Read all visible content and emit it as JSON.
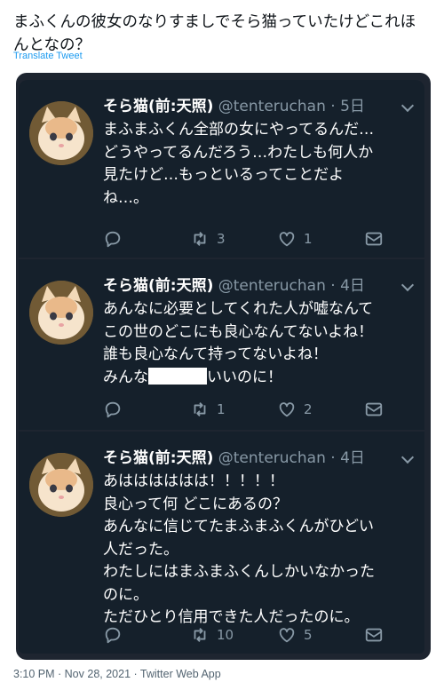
{
  "tweet": {
    "text": "まふくんの彼女のなりすましでそら猫っていたけどこれほんとなの？",
    "translate_label": "Translate Tweet",
    "timestamp": "3:10 PM · Nov 28, 2021",
    "source": "Twitter Web App"
  },
  "screenshot": {
    "tweets": [
      {
        "name": "そら猫(前:天照)",
        "handle": "@tenteruchan",
        "date": "5日",
        "lines": [
          "まふまふくん全部の女にやってるんだ…",
          "どうやってるんだろう…わたしも何人か",
          "見たけど…もっといるってことだよ",
          "ね…。"
        ],
        "replies": "",
        "retweets": "3",
        "likes": "1"
      },
      {
        "name": "そら猫(前:天照)",
        "handle": "@tenteruchan",
        "date": "4日",
        "lines": [
          "あんなに必要としてくれた人が嘘なんて",
          "この世のどこにも良心なんてないよね！",
          "誰も良心なんて持ってないよね！"
        ],
        "last_line_before": "みんな",
        "last_line_after": "いいのに！",
        "replies": "",
        "retweets": "1",
        "likes": "2"
      },
      {
        "name": "そら猫(前:天照)",
        "handle": "@tenteruchan",
        "date": "4日",
        "lines": [
          "あはははははは！！！！！",
          "良心って何 どこにあるの？",
          "あんなに信じてたまふまふくんがひどい",
          "人だった。",
          "わたしにはまふまふくんしかいなかった",
          "のに。",
          "ただひとり信用できた人だったのに。"
        ],
        "replies": "",
        "retweets": "10",
        "likes": "5"
      }
    ]
  },
  "icons": {
    "reply": "reply-icon",
    "retweet": "retweet-icon",
    "like": "heart-icon",
    "dm": "message-icon",
    "menu": "chevron-down-icon"
  },
  "colors": {
    "dark_bg": "#15202b",
    "frame_bg": "#1e2530",
    "muted": "#8899a6",
    "link": "#1d9bf0"
  }
}
